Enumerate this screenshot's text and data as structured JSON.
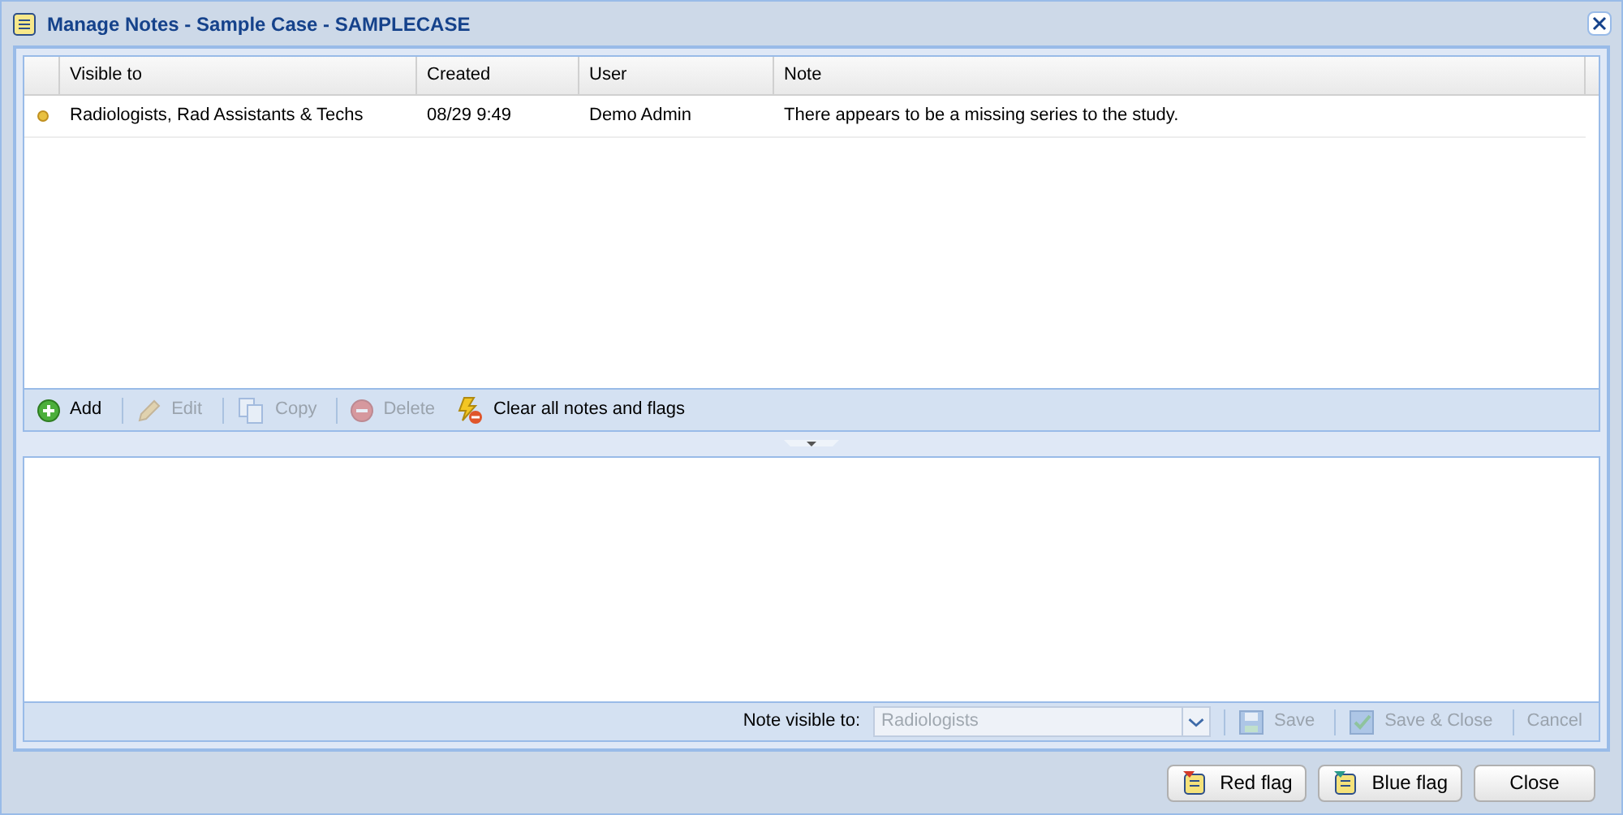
{
  "window": {
    "title": "Manage Notes - Sample Case - SAMPLECASE"
  },
  "table": {
    "columns": [
      "Visible to",
      "Created",
      "User",
      "Note"
    ],
    "rows": [
      {
        "visible_to": "Radiologists, Rad Assistants & Techs",
        "created": "08/29 9:49",
        "user": "Demo Admin",
        "note": "There appears to be a missing series to the study."
      }
    ]
  },
  "toolbar": [
    {
      "kind": "add",
      "label": "Add",
      "disabled": false
    },
    {
      "kind": "edit",
      "label": "Edit",
      "disabled": true
    },
    {
      "kind": "copy",
      "label": "Copy",
      "disabled": true
    },
    {
      "kind": "delete",
      "label": "Delete",
      "disabled": true
    },
    {
      "kind": "clear",
      "label": "Clear all notes and flags",
      "disabled": false
    }
  ],
  "editor": {
    "visibility_label": "Note visible to:",
    "visibility_value": "Radiologists",
    "visibility_disabled": true,
    "buttons": [
      {
        "kind": "save",
        "label": "Save",
        "disabled": true
      },
      {
        "kind": "save-close",
        "label": "Save & Close",
        "disabled": true
      },
      {
        "kind": "cancel",
        "label": "Cancel",
        "disabled": true
      }
    ]
  },
  "footer_buttons": [
    {
      "kind": "red-flag",
      "label": "Red flag"
    },
    {
      "kind": "blue-flag",
      "label": "Blue flag"
    },
    {
      "kind": "close",
      "label": "Close"
    }
  ]
}
